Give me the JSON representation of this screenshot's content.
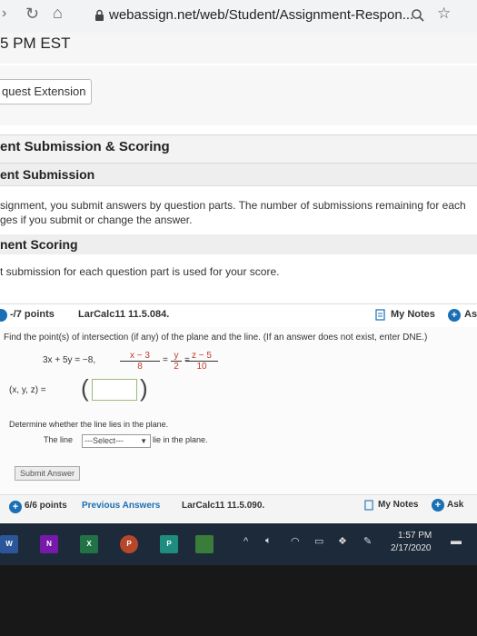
{
  "browser": {
    "url": "webassign.net/web/Student/Assignment-Respon..."
  },
  "header": {
    "time_text": "5 PM EST",
    "extension_button": "quest Extension"
  },
  "submission_scoring": {
    "title": "ent Submission & Scoring",
    "submission_heading": "ent Submission",
    "submission_text_line1": "signment, you submit answers by question parts. The number of submissions remaining for each",
    "submission_text_line2": "ges if you submit or change the answer.",
    "scoring_heading": "nent Scoring",
    "scoring_text": "t submission for each question part is used for your score."
  },
  "question": {
    "points": "-/7 points",
    "problem_id": "LarCalc11 11.5.084.",
    "my_notes": "My Notes",
    "ask_label": "As",
    "prompt": "Find the point(s) of intersection (if any) of the plane and the line. (If an answer does not exist, enter DNE.)",
    "plane_equation": "3x + 5y = −8,",
    "frac1_num": "x − 3",
    "frac1_den": "8",
    "frac2_num": "y",
    "frac2_den": "2",
    "frac3_num": "z − 5",
    "frac3_den": "10",
    "point_label": "(x, y, z) =",
    "determine_text": "Determine whether the line lies in the plane.",
    "the_line_label": "The line",
    "select_value": "---Select---",
    "lie_text": "lie in the plane.",
    "submit_label": "Submit Answer"
  },
  "next_question": {
    "points": "6/6 points",
    "previous_answers": "Previous Answers",
    "problem_id": "LarCalc11 11.5.090.",
    "my_notes": "My Notes",
    "ask_label": "Ask"
  },
  "taskbar": {
    "time": "1:57 PM",
    "date": "2/17/2020"
  },
  "colors": {
    "accent_blue": "#1a6fb5",
    "taskbar": "#1d2a3a"
  }
}
